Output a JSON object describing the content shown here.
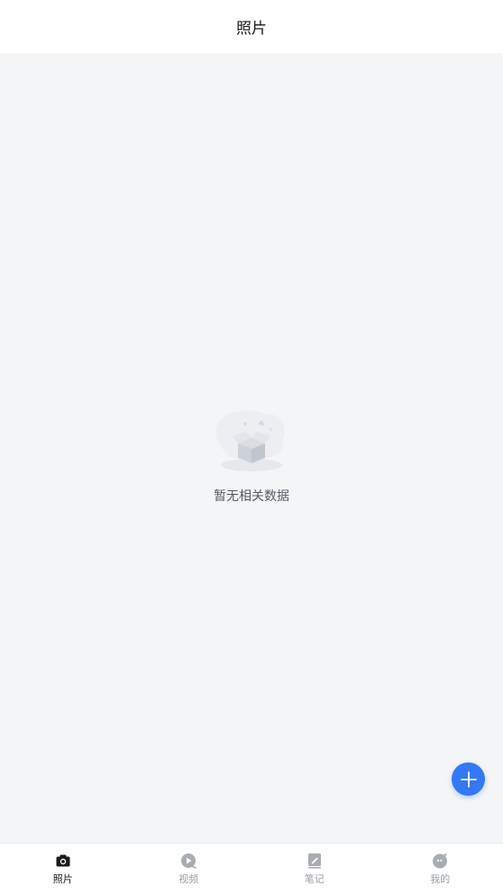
{
  "header": {
    "title": "照片"
  },
  "empty_state": {
    "message": "暂无相关数据",
    "illustration": "empty-box-illustration"
  },
  "fab": {
    "icon": "plus-icon",
    "color": "#3478f6"
  },
  "tabbar": {
    "active_index": 0,
    "active_color": "#1a1a1a",
    "inactive_color": "#9a9ea4",
    "items": [
      {
        "label": "照片",
        "icon": "camera-icon"
      },
      {
        "label": "视频",
        "icon": "play-icon"
      },
      {
        "label": "笔记",
        "icon": "note-icon"
      },
      {
        "label": "我的",
        "icon": "profile-icon"
      }
    ]
  }
}
